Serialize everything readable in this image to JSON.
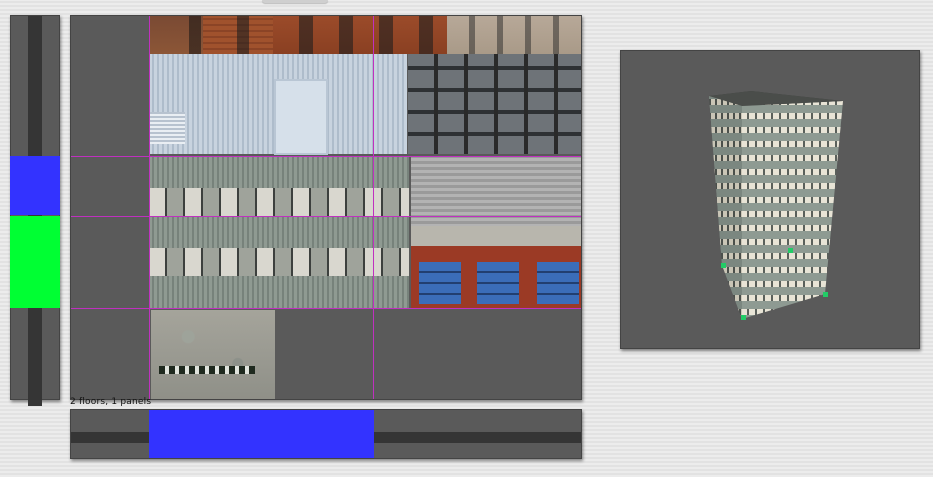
{
  "status_text": "2 floors, 1 panels",
  "colors": {
    "floor_marker_blue": "#3333ff",
    "floor_marker_green": "#00ff33",
    "guide_line": "#c030c0",
    "panel_bg": "#5a5a5a",
    "handle_green": "#22cc66"
  },
  "texture_atlas": {
    "tiles": [
      {
        "name": "brick-facade"
      },
      {
        "name": "corrugated-shed"
      },
      {
        "name": "glass-curtain-wall"
      },
      {
        "name": "office-window-bands"
      },
      {
        "name": "fire-station-doors"
      },
      {
        "name": "rooftop"
      }
    ]
  },
  "preview": {
    "subject_icon": "building-3d-icon"
  }
}
